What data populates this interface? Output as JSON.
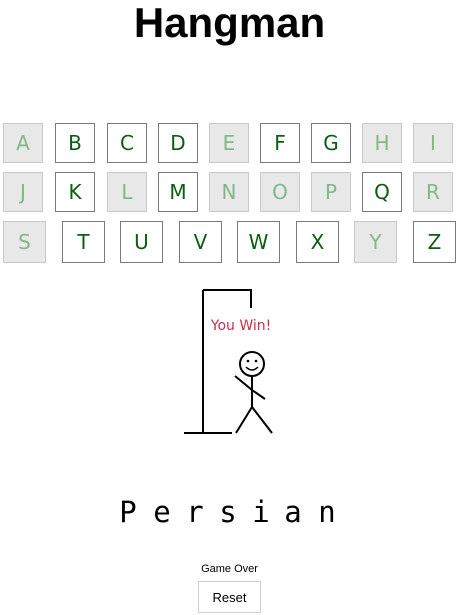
{
  "title": "Hangman",
  "keyboard": {
    "rows": [
      [
        {
          "letter": "A",
          "used": true
        },
        {
          "letter": "B",
          "used": false
        },
        {
          "letter": "C",
          "used": false
        },
        {
          "letter": "D",
          "used": false
        },
        {
          "letter": "E",
          "used": true
        },
        {
          "letter": "F",
          "used": false
        },
        {
          "letter": "G",
          "used": false
        },
        {
          "letter": "H",
          "used": true
        },
        {
          "letter": "I",
          "used": true
        }
      ],
      [
        {
          "letter": "J",
          "used": true
        },
        {
          "letter": "K",
          "used": false
        },
        {
          "letter": "L",
          "used": true
        },
        {
          "letter": "M",
          "used": false
        },
        {
          "letter": "N",
          "used": true
        },
        {
          "letter": "O",
          "used": true
        },
        {
          "letter": "P",
          "used": true
        },
        {
          "letter": "Q",
          "used": false
        },
        {
          "letter": "R",
          "used": true
        }
      ],
      [
        {
          "letter": "S",
          "used": true
        },
        {
          "letter": "T",
          "used": false
        },
        {
          "letter": "U",
          "used": false
        },
        {
          "letter": "V",
          "used": false
        },
        {
          "letter": "W",
          "used": false
        },
        {
          "letter": "X",
          "used": false
        },
        {
          "letter": "Y",
          "used": true
        },
        {
          "letter": "Z",
          "used": false
        }
      ]
    ]
  },
  "result_message": "You Win!",
  "word_letters": [
    "P",
    "e",
    "r",
    "s",
    "i",
    "a",
    "n"
  ],
  "status": "Game Over",
  "reset_label": "Reset",
  "colors": {
    "key_text": "#0b5d14",
    "used_key_text": "#7fb984",
    "used_key_bg": "#e8e8e8",
    "win_text": "#c0334a"
  }
}
